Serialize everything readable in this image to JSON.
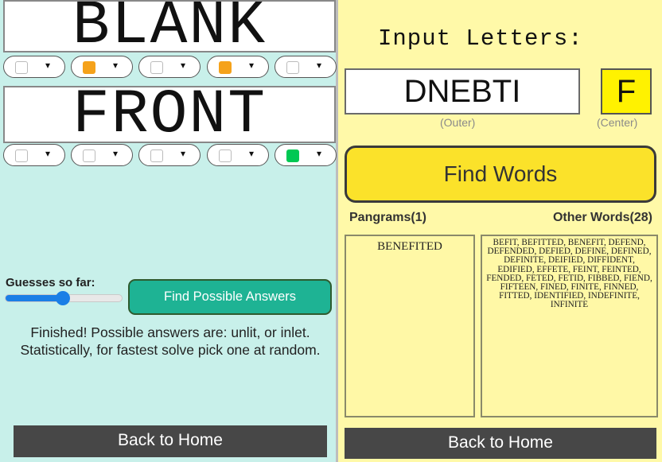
{
  "left": {
    "word1": "BLANK",
    "word2": "FRONT",
    "pills_row1": [
      {
        "color": "#ffffff"
      },
      {
        "color": "#f5a21b"
      },
      {
        "color": "#ffffff"
      },
      {
        "color": "#f5a21b"
      },
      {
        "color": "#ffffff"
      }
    ],
    "pills_row2": [
      {
        "color": "#ffffff"
      },
      {
        "color": "#ffffff"
      },
      {
        "color": "#ffffff"
      },
      {
        "color": "#ffffff"
      },
      {
        "color": "#00c853"
      }
    ],
    "caret": "▾",
    "guesses_label": "Guesses so far:",
    "guesses_slider_fraction": 0.49,
    "find_possible_label": "Find Possible Answers",
    "finished_text": "Finished! Possible answers are: unlit, or inlet. Statistically, for fastest solve pick one at random.",
    "back_label": "Back to Home"
  },
  "right": {
    "input_title": "Input Letters:",
    "outer_value": "DNEBTI",
    "outer_caption": "(Outer)",
    "center_value": "F",
    "center_caption": "(Center)",
    "find_words_label": "Find Words",
    "pangrams_heading": "Pangrams(1)",
    "other_heading": "Other Words(28)",
    "pangrams": "BENEFITED",
    "other_words": "BEFIT, BEFITTED, BENEFIT, DEFEND, DEFENDED, DEFIED, DEFINE, DEFINED, DEFINITE, DEIFIED, DIFFIDENT, EDIFIED, EFFETE, FEINT, FEINTED, FENDED, FETED, FETID, FIBBED, FIEND, FIFTEEN, FINED, FINITE, FINNED, FITTED, IDENTIFIED, INDEFINITE, INFINITE",
    "back_label": "Back to Home"
  },
  "colors": {
    "left_bg": "#c8f0ea",
    "right_bg": "#fff9a8",
    "yellow_tile": "#fff200",
    "teal_button": "#1eb394",
    "find_words_button": "#fbe22a",
    "back_button": "#474747",
    "yellow_mark": "#f5a21b",
    "green_mark": "#00c853"
  }
}
